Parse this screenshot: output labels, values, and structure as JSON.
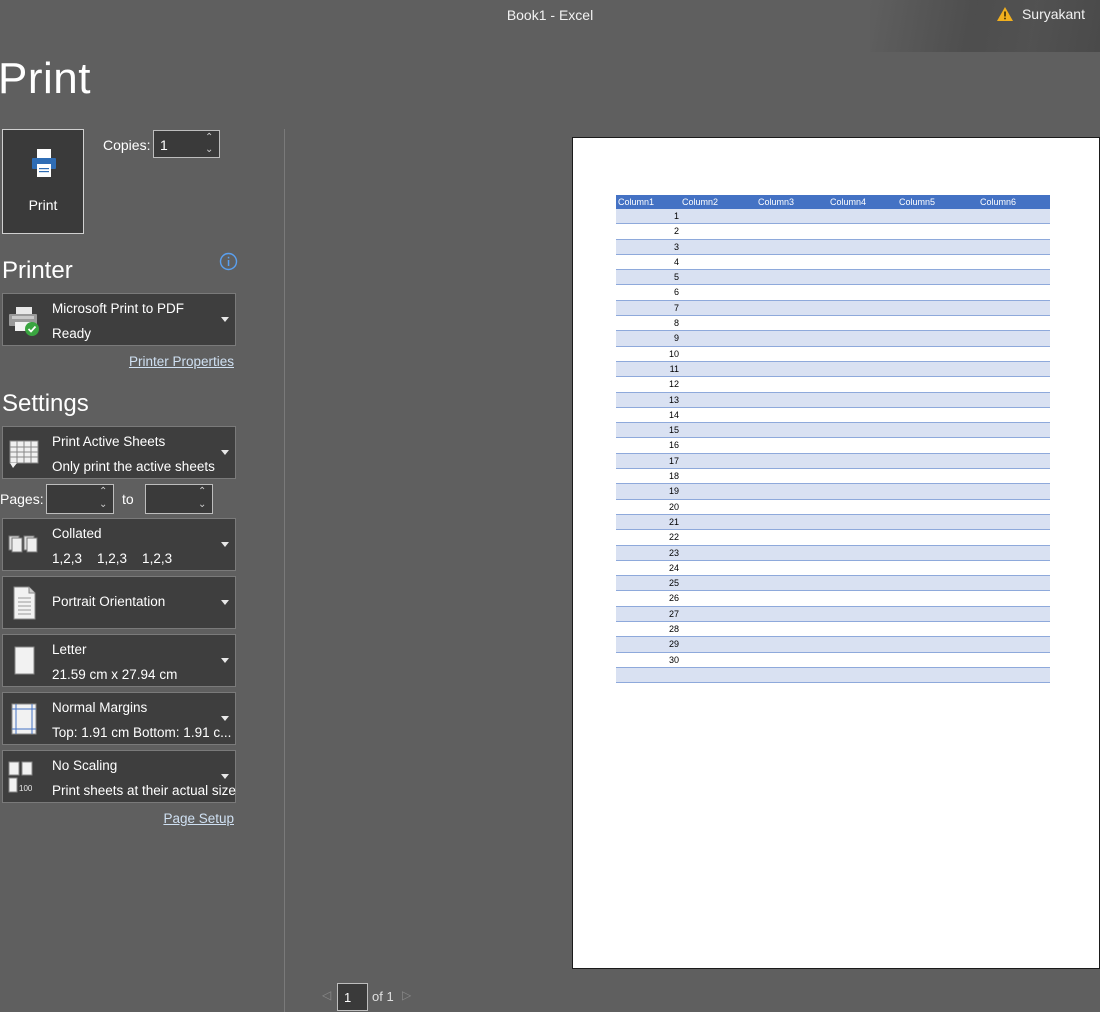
{
  "window": {
    "title": "Book1  -  Excel",
    "user_name": "Suryakant"
  },
  "page_title": "Print",
  "print_button": {
    "label": "Print"
  },
  "copies": {
    "label": "Copies:",
    "value": "1"
  },
  "printer": {
    "heading": "Printer",
    "name": "Microsoft Print to PDF",
    "status": "Ready",
    "properties_link": "Printer Properties"
  },
  "settings": {
    "heading": "Settings",
    "what": {
      "line1": "Print Active Sheets",
      "line2": "Only print the active sheets"
    },
    "pages": {
      "label": "Pages:",
      "from_value": "",
      "to_label": "to",
      "to_value": ""
    },
    "collation": {
      "line1": "Collated",
      "line2": "1,2,3    1,2,3    1,2,3"
    },
    "orientation": {
      "line1": "Portrait Orientation"
    },
    "paper": {
      "line1": "Letter",
      "line2": "21.59 cm x 27.94 cm"
    },
    "margins": {
      "line1": "Normal Margins",
      "line2": "Top: 1.91 cm Bottom: 1.91 c..."
    },
    "scaling": {
      "line1": "No Scaling",
      "line2": "Print sheets at their actual size",
      "icon_text": "100"
    },
    "page_setup_link": "Page Setup"
  },
  "preview": {
    "table_headers": [
      "Column1",
      "Column2",
      "Column3",
      "Column4",
      "Column5",
      "Column6"
    ],
    "rows": [
      "1",
      "2",
      "3",
      "4",
      "5",
      "6",
      "7",
      "8",
      "9",
      "10",
      "11",
      "12",
      "13",
      "14",
      "15",
      "16",
      "17",
      "18",
      "19",
      "20",
      "21",
      "22",
      "23",
      "24",
      "25",
      "26",
      "27",
      "28",
      "29",
      "30",
      ""
    ],
    "header_color": "#4472c4",
    "band_color": "#d9e1f2"
  },
  "pager": {
    "current": "1",
    "of_text": "of 1"
  }
}
